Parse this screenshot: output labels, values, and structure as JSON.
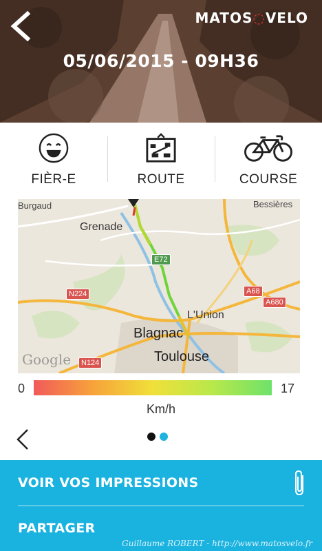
{
  "header": {
    "date_time": "05/06/2015 - 09H36",
    "logo_left": "MATOS",
    "logo_right": "VELO"
  },
  "categories": [
    {
      "label": "FIÈR-E",
      "icon": "smiley-icon"
    },
    {
      "label": "ROUTE",
      "icon": "road-sign-icon"
    },
    {
      "label": "COURSE",
      "icon": "road-bike-icon"
    }
  ],
  "map": {
    "places": {
      "burgaud": "Burgaud",
      "bessieres": "Bessières",
      "grenade": "Grenade",
      "lunion": "L'Union",
      "blagnac": "Blagnac",
      "toulouse": "Toulouse"
    },
    "roads": {
      "e72": "E72",
      "n224": "N224",
      "a68": "A68",
      "a680": "A680",
      "n124": "N124"
    },
    "watermark": "Google"
  },
  "speed_scale": {
    "min": "0",
    "max": "17",
    "unit": "Km/h",
    "colors": [
      "#f15a5a",
      "#f7a33a",
      "#f0e03a",
      "#b8e84a",
      "#6ee26a"
    ]
  },
  "pager": {
    "total": 2,
    "active_index": 1,
    "active_color": "#1fb4e0"
  },
  "actions": {
    "impressions_label": "VOIR VOS IMPRESSIONS",
    "share_label": "PARTAGER",
    "accent_color": "#1ab2df"
  },
  "credit": "Guillaume ROBERT - http://www.matosvelo.fr"
}
